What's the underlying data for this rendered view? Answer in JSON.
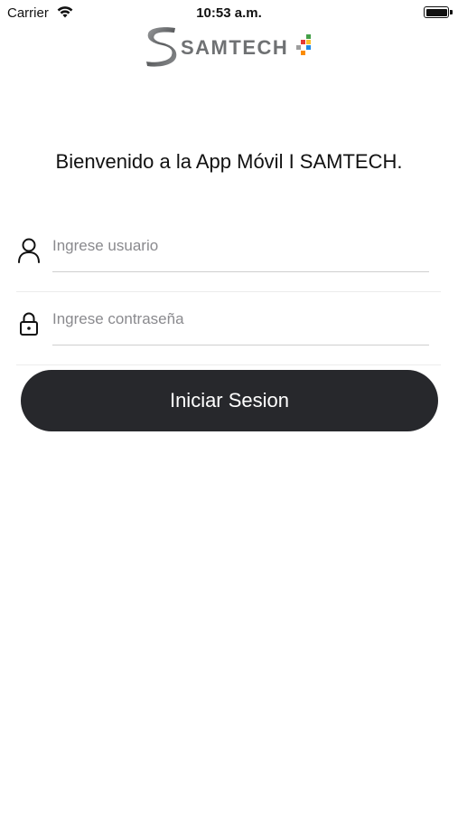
{
  "status_bar": {
    "carrier": "Carrier",
    "time": "10:53 a.m.",
    "icons": [
      "wifi-icon",
      "battery-icon"
    ]
  },
  "logo": {
    "text": "SAMTECH",
    "colors": {
      "text": "#6f7173",
      "dots": [
        "#e53935",
        "#43a047",
        "#fbc02d",
        "#1e88e5",
        "#9e9e9e"
      ]
    }
  },
  "welcome": {
    "message": "Bienvenido a la App Móvil I SAMTECH."
  },
  "form": {
    "username": {
      "value": "",
      "placeholder": "Ingrese usuario",
      "icon": "user-icon"
    },
    "password": {
      "value": "",
      "placeholder": "Ingrese contraseña",
      "icon": "lock-icon"
    },
    "submit_label": "Iniciar Sesion"
  },
  "colors": {
    "button_background": "#27282c",
    "button_text": "#ffffff",
    "placeholder": "#8a8a8e",
    "divider": "#ececec"
  }
}
